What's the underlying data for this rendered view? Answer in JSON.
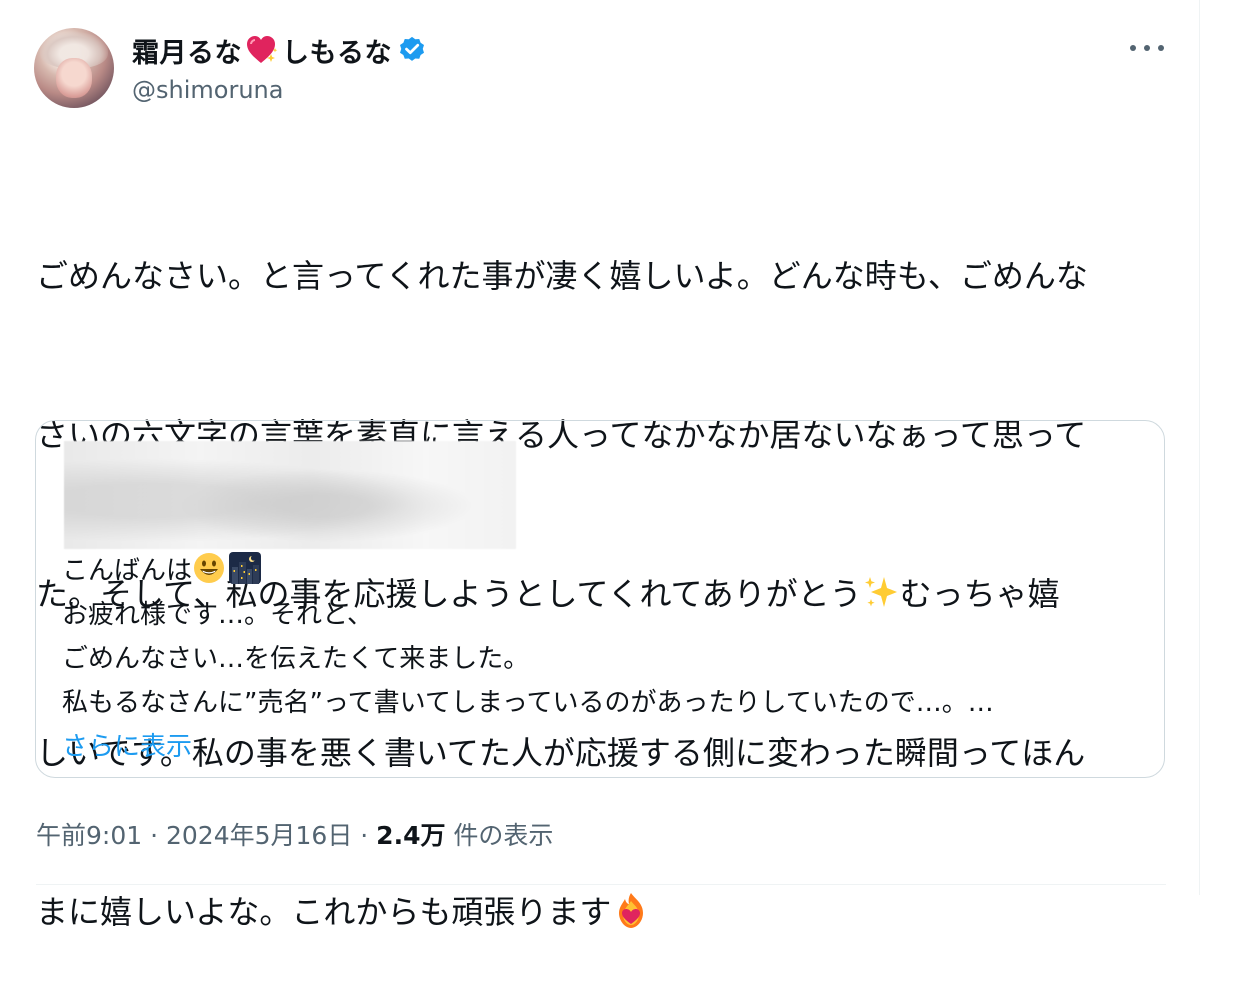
{
  "author": {
    "display_name_part1": "霜月るな",
    "display_name_part2": "しもるな",
    "handle": "@shimoruna",
    "name_emoji": "sparkling-heart-icon",
    "verified": true,
    "colors": {
      "verified_blue": "#1d9bf0"
    }
  },
  "tweet": {
    "line1": "ごめんなさい。と言ってくれた事が凄く嬉しいよ。どんな時も、ごめんな",
    "line2": "さいの六文字の言葉を素直に言える人ってなかなか居ないなぁって思って",
    "line3": "た。そして、私の事を応援しようとしてくれてありがとう",
    "line3_emoji": "sparkles-icon",
    "line3_end": "むっちゃ嬉",
    "line4": "しいです。私の事を悪く書いてた人が応援する側に変わった瞬間ってほん",
    "line5": "まに嬉しいよな。これからも頑張ります",
    "line5_emoji": "heart-on-fire-icon"
  },
  "quote": {
    "line1": "こんばんは",
    "line1_emojis": [
      "grinning-face-icon",
      "night-city-icon"
    ],
    "line2": "お疲れ様です…。それと、",
    "line3": "ごめんなさい…を伝えたくて来ました。",
    "line4": "私もるなさんに”売名”って書いてしまっているのがあったりしていたので…。…",
    "show_more": "さらに表示"
  },
  "meta": {
    "time": "午前9:01",
    "sep": " · ",
    "date": "2024年5月16日",
    "views_count": "2.4万",
    "views_label": " 件の表示"
  },
  "more_icon": "more-options-icon"
}
